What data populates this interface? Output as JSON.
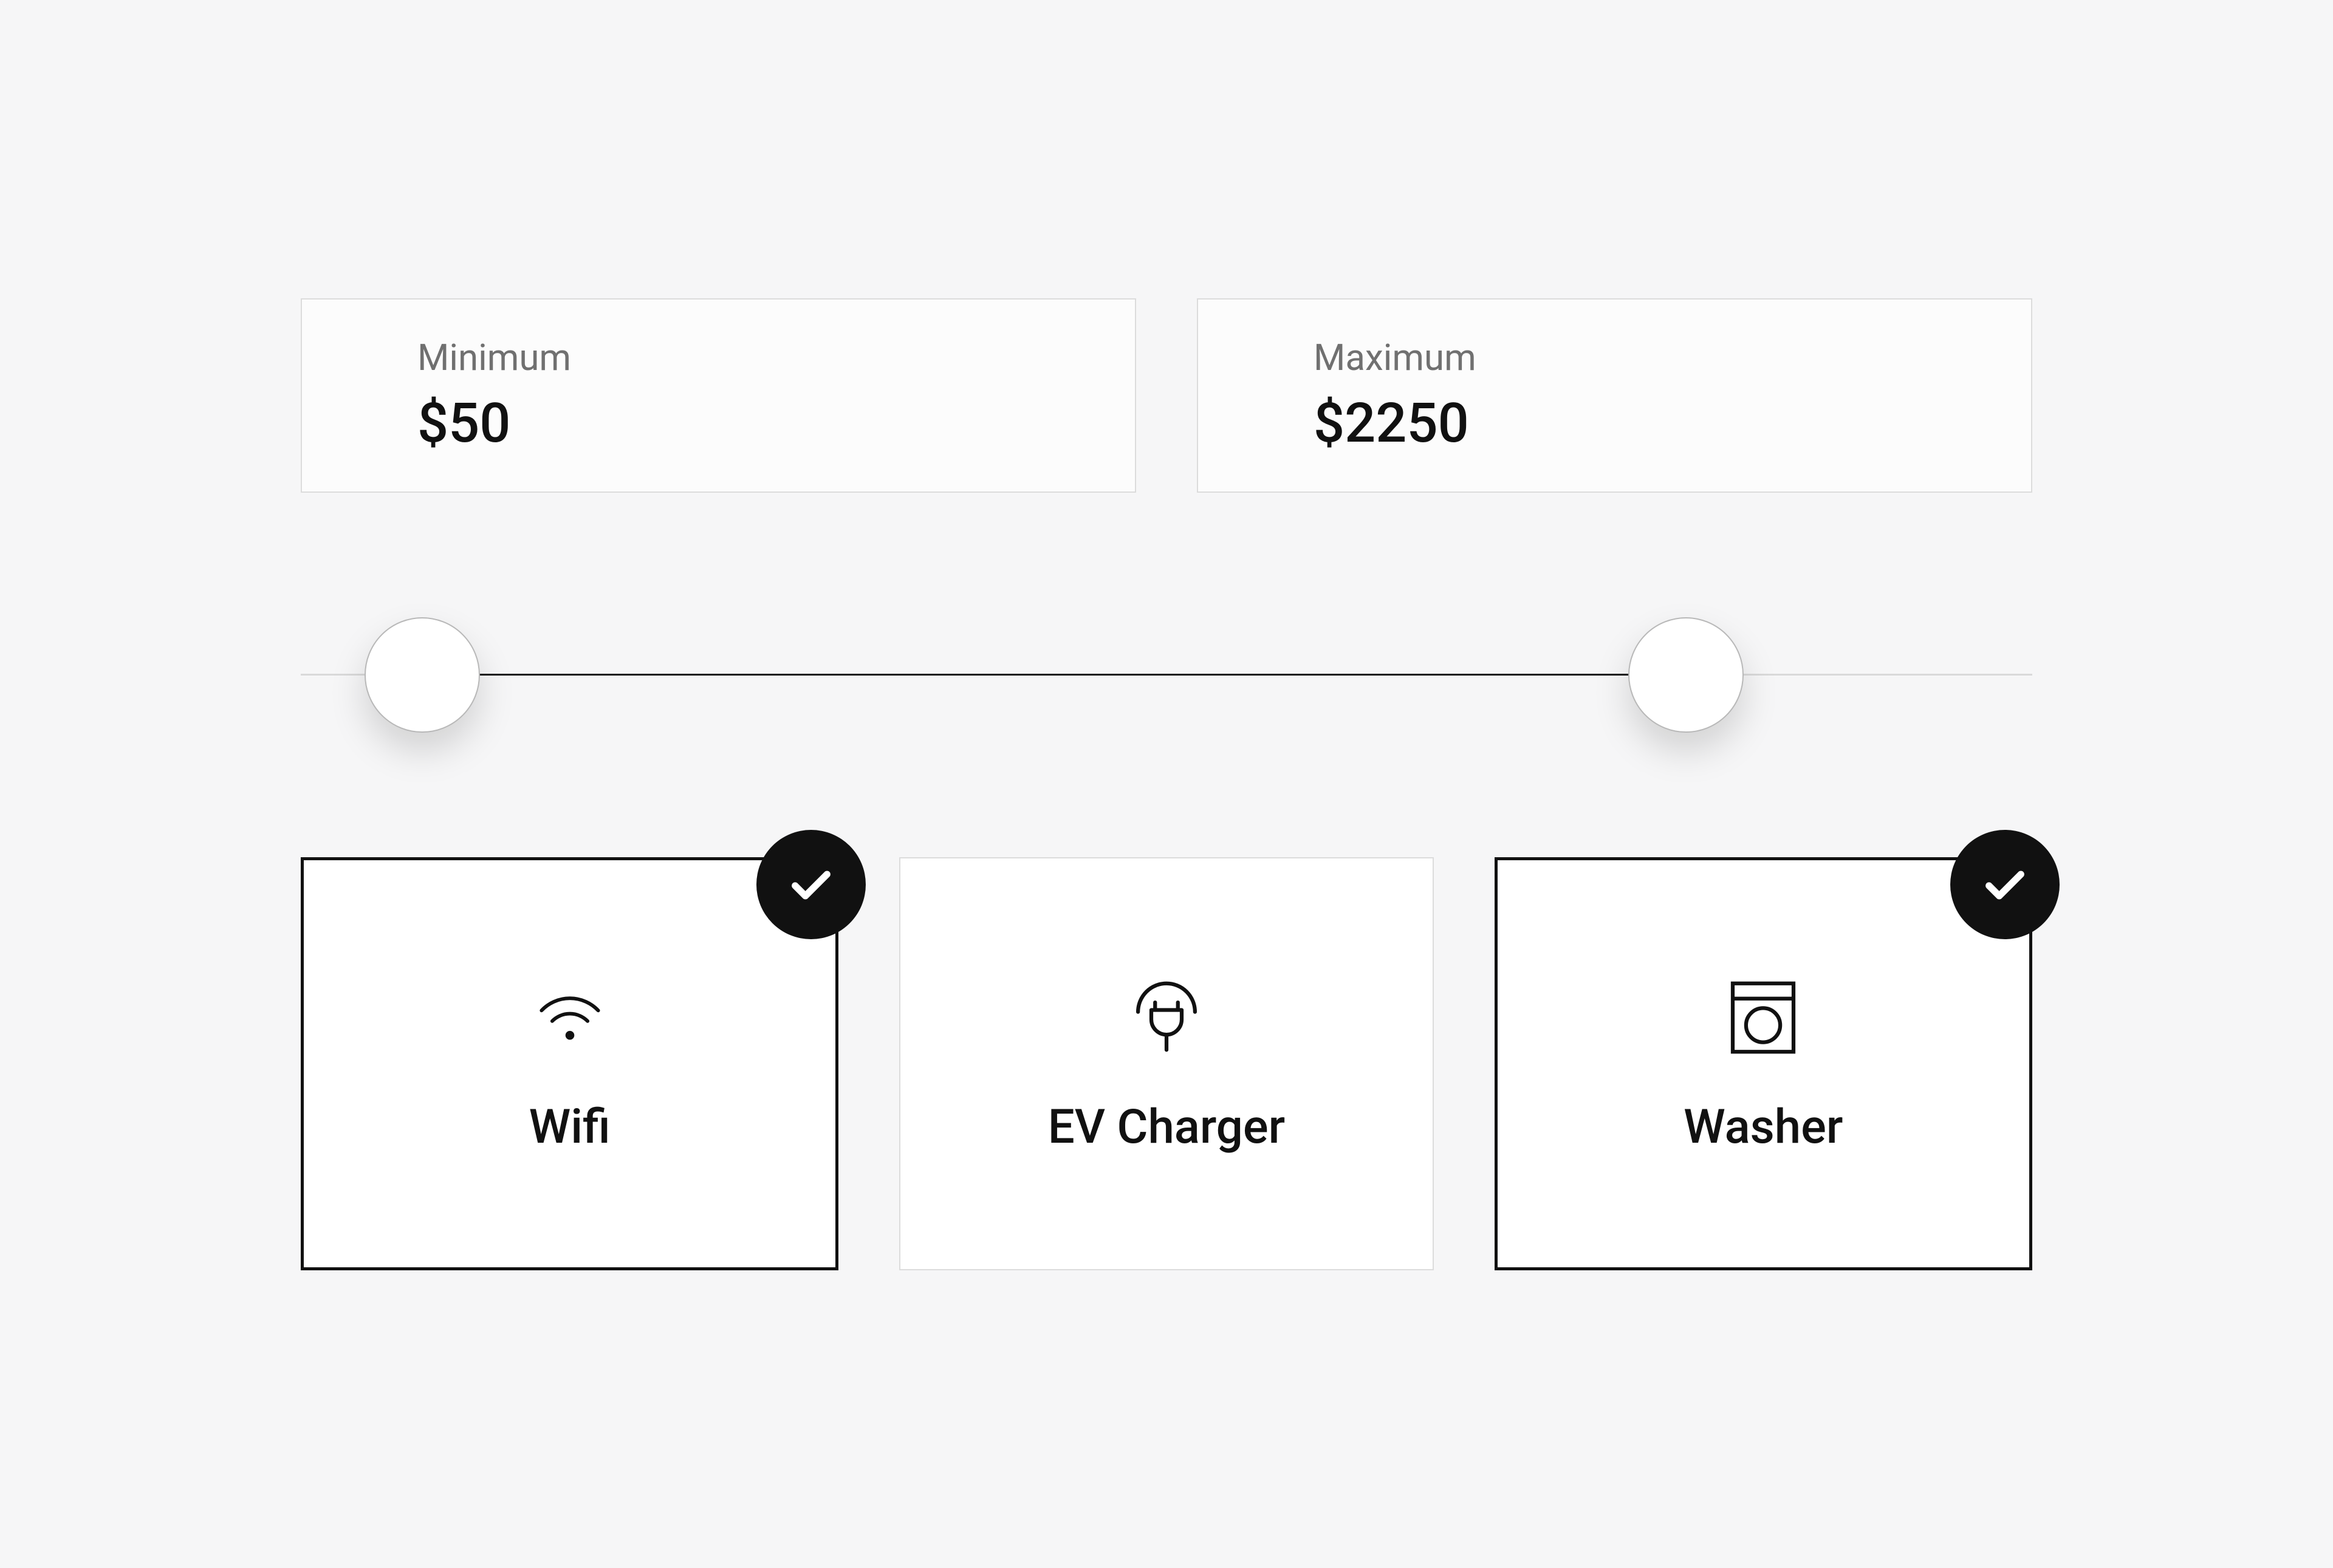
{
  "price": {
    "min_label": "Minimum",
    "min_value": "$50",
    "max_label": "Maximum",
    "max_value": "$2250",
    "slider": {
      "min_pct": 7,
      "max_pct": 80
    }
  },
  "amenities": {
    "wifi": {
      "label": "Wifi",
      "selected": true
    },
    "ev": {
      "label": "EV Charger",
      "selected": false
    },
    "washer": {
      "label": "Washer",
      "selected": true
    }
  }
}
